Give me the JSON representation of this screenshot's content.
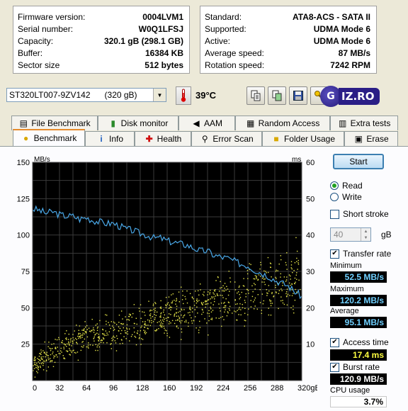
{
  "info": {
    "left": [
      {
        "label": "Firmware version:",
        "value": "0004LVM1"
      },
      {
        "label": "Serial number:",
        "value": "W0Q1LFSJ"
      },
      {
        "label": "Capacity:",
        "value": "320.1 gB (298.1 GB)"
      },
      {
        "label": "Buffer:",
        "value": "16384 KB"
      },
      {
        "label": "Sector size",
        "value": "512 bytes"
      }
    ],
    "right": [
      {
        "label": "Standard:",
        "value": "ATA8-ACS - SATA II"
      },
      {
        "label": "Supported:",
        "value": "UDMA Mode 6"
      },
      {
        "label": "Active:",
        "value": "UDMA Mode 6"
      },
      {
        "label": "Average speed:",
        "value": "87 MB/s"
      },
      {
        "label": "Rotation speed:",
        "value": "7242 RPM"
      }
    ]
  },
  "toolbar": {
    "drive": "ST320LT007-9ZV142      (320 gB)",
    "temperature": "39°C",
    "logo_text": "IZ.RO",
    "logo_letter": "G"
  },
  "tabs": {
    "row1": [
      "File Benchmark",
      "Disk monitor",
      "AAM",
      "Random Access",
      "Extra tests"
    ],
    "row2": [
      "Benchmark",
      "Info",
      "Health",
      "Error Scan",
      "Folder Usage",
      "Erase"
    ]
  },
  "side": {
    "start": "Start",
    "read": "Read",
    "write": "Write",
    "short_stroke": "Short stroke",
    "stroke_value": "40",
    "stroke_unit": "gB",
    "transfer_rate": "Transfer rate",
    "minimum_label": "Minimum",
    "minimum": "52.5 MB/s",
    "maximum_label": "Maximum",
    "maximum": "120.2 MB/s",
    "average_label": "Average",
    "average": "95.1 MB/s",
    "access_time": "Access time",
    "access_value": "17.4 ms",
    "burst_rate": "Burst rate",
    "burst_value": "120.9 MB/s",
    "cpu_label": "CPU usage",
    "cpu_value": "3.7%"
  },
  "colors": {
    "transfer": "#4aa8e8",
    "access": "#e8e84a",
    "plot_bg": "#000000",
    "grid": "#3a3a3a"
  },
  "chart_data": {
    "type": "line",
    "left_unit": "MB/s",
    "right_unit": "ms",
    "x_ticks": [
      "0",
      "32",
      "64",
      "96",
      "128",
      "160",
      "192",
      "224",
      "256",
      "288",
      "320gB"
    ],
    "y_left_ticks": [
      "25",
      "50",
      "75",
      "100",
      "125",
      "150"
    ],
    "y_right_ticks": [
      "10",
      "20",
      "30",
      "40",
      "50",
      "60"
    ],
    "xlim": [
      0,
      320
    ],
    "ylim_left": [
      0,
      150
    ],
    "ylim_right": [
      0,
      60
    ],
    "series": [
      {
        "axis": "left",
        "points": [
          [
            0,
            118
          ],
          [
            8,
            117
          ],
          [
            16,
            115
          ],
          [
            24,
            116
          ],
          [
            32,
            114
          ],
          [
            40,
            113
          ],
          [
            48,
            113
          ],
          [
            56,
            111
          ],
          [
            64,
            112
          ],
          [
            72,
            110
          ],
          [
            80,
            109
          ],
          [
            88,
            108
          ],
          [
            96,
            108
          ],
          [
            104,
            106
          ],
          [
            112,
            104
          ],
          [
            120,
            103
          ],
          [
            128,
            101
          ],
          [
            136,
            100
          ],
          [
            144,
            98
          ],
          [
            152,
            98
          ],
          [
            160,
            96
          ],
          [
            168,
            95
          ],
          [
            176,
            94
          ],
          [
            184,
            93
          ],
          [
            192,
            91
          ],
          [
            200,
            89
          ],
          [
            208,
            89
          ],
          [
            216,
            86
          ],
          [
            224,
            85
          ],
          [
            232,
            84
          ],
          [
            240,
            82
          ],
          [
            248,
            80
          ],
          [
            256,
            79
          ],
          [
            264,
            76
          ],
          [
            272,
            74
          ],
          [
            280,
            72
          ],
          [
            288,
            69
          ],
          [
            296,
            67
          ],
          [
            304,
            65
          ],
          [
            312,
            61
          ],
          [
            320,
            58
          ]
        ]
      },
      {
        "axis": "right",
        "kind": "scatter",
        "trend": [
          [
            0,
            4.5
          ],
          [
            32,
            9
          ],
          [
            64,
            12
          ],
          [
            96,
            14
          ],
          [
            128,
            16
          ],
          [
            160,
            18
          ],
          [
            192,
            20
          ],
          [
            224,
            22
          ],
          [
            256,
            24
          ],
          [
            288,
            27
          ],
          [
            320,
            29
          ]
        ]
      }
    ]
  }
}
